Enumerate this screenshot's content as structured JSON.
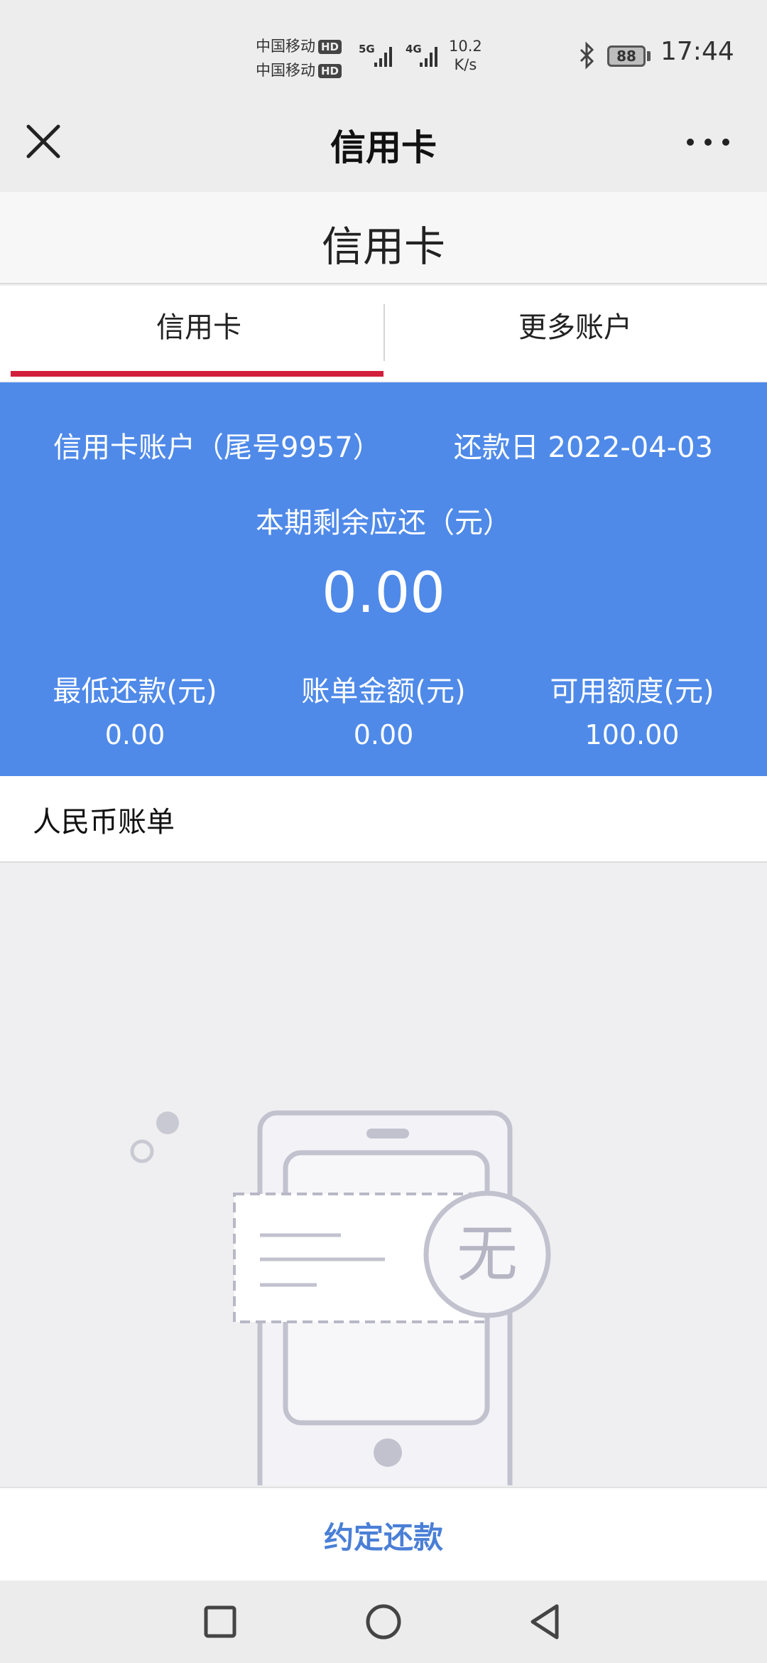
{
  "status_bar": {
    "carrier_1": "中国移动",
    "carrier_2": "中国移动",
    "hd": "HD",
    "network_1": "5G",
    "network_2": "4G",
    "speed_value": "10.2",
    "speed_unit": "K/s",
    "battery": "88",
    "time": "17:44"
  },
  "titlebar": {
    "title": "信用卡"
  },
  "subheader": {
    "title": "信用卡"
  },
  "tabs": [
    {
      "label": "信用卡",
      "active": true
    },
    {
      "label": "更多账户",
      "active": false
    }
  ],
  "card": {
    "account": "信用卡账户（尾号9957）",
    "due_date": "还款日 2022-04-03",
    "remaining_label": "本期剩余应还（元）",
    "remaining_amount": "0.00",
    "stats": [
      {
        "label": "最低还款(元)",
        "value": "0.00"
      },
      {
        "label": "账单金额(元)",
        "value": "0.00"
      },
      {
        "label": "可用额度(元)",
        "value": "100.00"
      }
    ]
  },
  "bill": {
    "section_label": "人民币账单",
    "empty_glyph": "无"
  },
  "action": {
    "label": "约定还款"
  },
  "colors": {
    "card_blue": "#4f8ae9",
    "tab_active_underline": "#d21f3c",
    "action_text": "#4a7fd6"
  }
}
